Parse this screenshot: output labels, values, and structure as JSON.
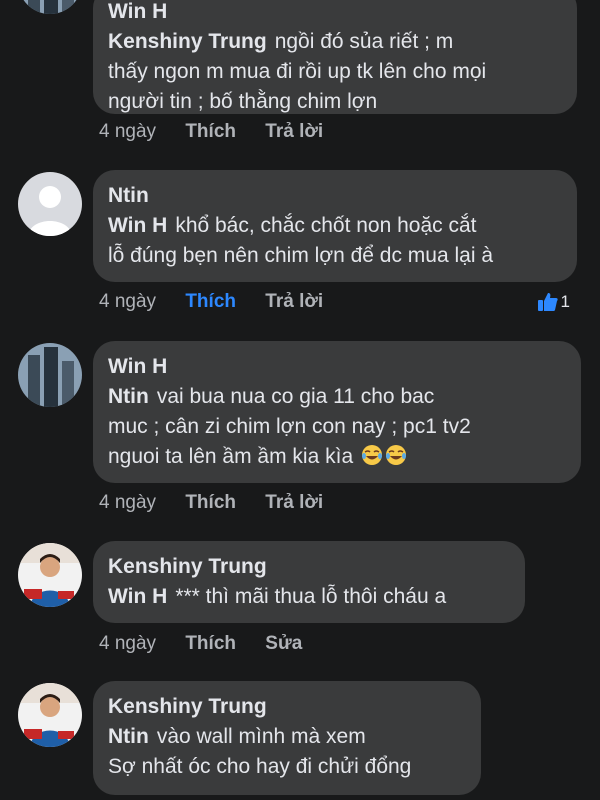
{
  "comments": [
    {
      "avatar": "building-avatar",
      "author": "Win H",
      "mention": "Kenshiny Trung",
      "lines": [
        "ngồi đó sủa riết ; m",
        "thấy ngon m mua đi rồi up tk lên cho mọi",
        "người tin ; bố thằng chim lợn"
      ],
      "time": "4 ngày",
      "like": "Thích",
      "reply": "Trả lời"
    },
    {
      "avatar": "default-avatar",
      "author": "Ntin",
      "mention": "Win H",
      "lines": [
        "khổ bác, chắc chốt non hoặc cắt",
        "lỗ đúng bẹn nên chim lợn để dc mua lại à"
      ],
      "time": "4 ngày",
      "like": "Thích",
      "reply": "Trả lời",
      "reaction_count": "1"
    },
    {
      "avatar": "building-avatar",
      "author": "Win H",
      "mention": "Ntin",
      "lines": [
        "vai bua nua co gia 11 cho bac",
        "muc ; cân zi chim lợn con nay ; pc1 tv2",
        "nguoi ta lên ầm ầm kia kìa"
      ],
      "emoji": "laughing-emoji",
      "time": "4 ngày",
      "like": "Thích",
      "reply": "Trả lời"
    },
    {
      "avatar": "person-avatar",
      "author": "Kenshiny Trung",
      "mention": "Win H",
      "lines": [
        "*** thì mãi thua lỗ thôi cháu a"
      ],
      "time": "4 ngày",
      "like": "Thích",
      "reply": "Sửa"
    },
    {
      "avatar": "person-avatar",
      "author": "Kenshiny Trung",
      "mention": "Ntin",
      "lines": [
        "vào wall mình mà xem",
        "Sợ nhất óc cho hay đi chửi đổng"
      ]
    }
  ],
  "colors": {
    "background": "#18191a",
    "bubble": "#3a3b3c",
    "text": "#e4e6eb",
    "meta": "#b0b3b8",
    "accent": "#2d88ff"
  }
}
